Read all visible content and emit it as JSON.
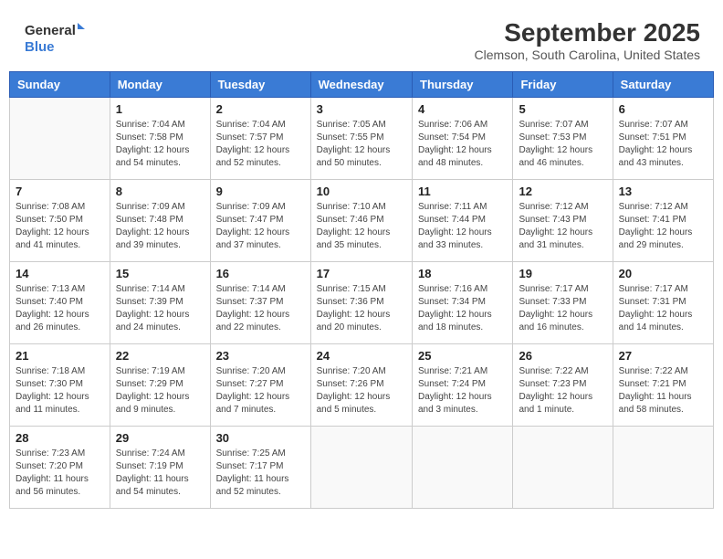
{
  "app": {
    "name": "GeneralBlue",
    "logo_text_line1": "General",
    "logo_text_line2": "Blue"
  },
  "title": "September 2025",
  "subtitle": "Clemson, South Carolina, United States",
  "days_of_week": [
    "Sunday",
    "Monday",
    "Tuesday",
    "Wednesday",
    "Thursday",
    "Friday",
    "Saturday"
  ],
  "weeks": [
    [
      {
        "day": "",
        "info": ""
      },
      {
        "day": "1",
        "info": "Sunrise: 7:04 AM\nSunset: 7:58 PM\nDaylight: 12 hours and 54 minutes."
      },
      {
        "day": "2",
        "info": "Sunrise: 7:04 AM\nSunset: 7:57 PM\nDaylight: 12 hours and 52 minutes."
      },
      {
        "day": "3",
        "info": "Sunrise: 7:05 AM\nSunset: 7:55 PM\nDaylight: 12 hours and 50 minutes."
      },
      {
        "day": "4",
        "info": "Sunrise: 7:06 AM\nSunset: 7:54 PM\nDaylight: 12 hours and 48 minutes."
      },
      {
        "day": "5",
        "info": "Sunrise: 7:07 AM\nSunset: 7:53 PM\nDaylight: 12 hours and 46 minutes."
      },
      {
        "day": "6",
        "info": "Sunrise: 7:07 AM\nSunset: 7:51 PM\nDaylight: 12 hours and 43 minutes."
      }
    ],
    [
      {
        "day": "7",
        "info": "Sunrise: 7:08 AM\nSunset: 7:50 PM\nDaylight: 12 hours and 41 minutes."
      },
      {
        "day": "8",
        "info": "Sunrise: 7:09 AM\nSunset: 7:48 PM\nDaylight: 12 hours and 39 minutes."
      },
      {
        "day": "9",
        "info": "Sunrise: 7:09 AM\nSunset: 7:47 PM\nDaylight: 12 hours and 37 minutes."
      },
      {
        "day": "10",
        "info": "Sunrise: 7:10 AM\nSunset: 7:46 PM\nDaylight: 12 hours and 35 minutes."
      },
      {
        "day": "11",
        "info": "Sunrise: 7:11 AM\nSunset: 7:44 PM\nDaylight: 12 hours and 33 minutes."
      },
      {
        "day": "12",
        "info": "Sunrise: 7:12 AM\nSunset: 7:43 PM\nDaylight: 12 hours and 31 minutes."
      },
      {
        "day": "13",
        "info": "Sunrise: 7:12 AM\nSunset: 7:41 PM\nDaylight: 12 hours and 29 minutes."
      }
    ],
    [
      {
        "day": "14",
        "info": "Sunrise: 7:13 AM\nSunset: 7:40 PM\nDaylight: 12 hours and 26 minutes."
      },
      {
        "day": "15",
        "info": "Sunrise: 7:14 AM\nSunset: 7:39 PM\nDaylight: 12 hours and 24 minutes."
      },
      {
        "day": "16",
        "info": "Sunrise: 7:14 AM\nSunset: 7:37 PM\nDaylight: 12 hours and 22 minutes."
      },
      {
        "day": "17",
        "info": "Sunrise: 7:15 AM\nSunset: 7:36 PM\nDaylight: 12 hours and 20 minutes."
      },
      {
        "day": "18",
        "info": "Sunrise: 7:16 AM\nSunset: 7:34 PM\nDaylight: 12 hours and 18 minutes."
      },
      {
        "day": "19",
        "info": "Sunrise: 7:17 AM\nSunset: 7:33 PM\nDaylight: 12 hours and 16 minutes."
      },
      {
        "day": "20",
        "info": "Sunrise: 7:17 AM\nSunset: 7:31 PM\nDaylight: 12 hours and 14 minutes."
      }
    ],
    [
      {
        "day": "21",
        "info": "Sunrise: 7:18 AM\nSunset: 7:30 PM\nDaylight: 12 hours and 11 minutes."
      },
      {
        "day": "22",
        "info": "Sunrise: 7:19 AM\nSunset: 7:29 PM\nDaylight: 12 hours and 9 minutes."
      },
      {
        "day": "23",
        "info": "Sunrise: 7:20 AM\nSunset: 7:27 PM\nDaylight: 12 hours and 7 minutes."
      },
      {
        "day": "24",
        "info": "Sunrise: 7:20 AM\nSunset: 7:26 PM\nDaylight: 12 hours and 5 minutes."
      },
      {
        "day": "25",
        "info": "Sunrise: 7:21 AM\nSunset: 7:24 PM\nDaylight: 12 hours and 3 minutes."
      },
      {
        "day": "26",
        "info": "Sunrise: 7:22 AM\nSunset: 7:23 PM\nDaylight: 12 hours and 1 minute."
      },
      {
        "day": "27",
        "info": "Sunrise: 7:22 AM\nSunset: 7:21 PM\nDaylight: 11 hours and 58 minutes."
      }
    ],
    [
      {
        "day": "28",
        "info": "Sunrise: 7:23 AM\nSunset: 7:20 PM\nDaylight: 11 hours and 56 minutes."
      },
      {
        "day": "29",
        "info": "Sunrise: 7:24 AM\nSunset: 7:19 PM\nDaylight: 11 hours and 54 minutes."
      },
      {
        "day": "30",
        "info": "Sunrise: 7:25 AM\nSunset: 7:17 PM\nDaylight: 11 hours and 52 minutes."
      },
      {
        "day": "",
        "info": ""
      },
      {
        "day": "",
        "info": ""
      },
      {
        "day": "",
        "info": ""
      },
      {
        "day": "",
        "info": ""
      }
    ]
  ]
}
